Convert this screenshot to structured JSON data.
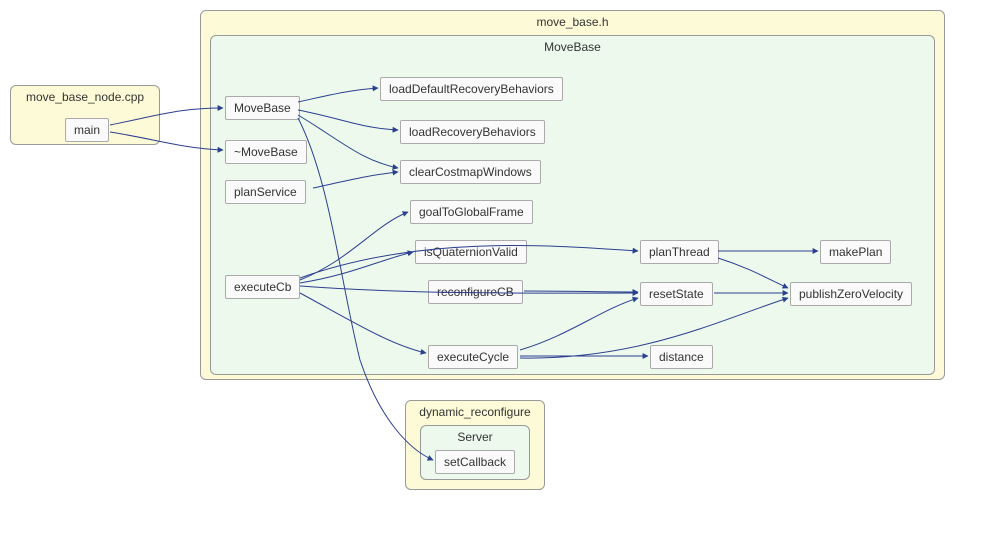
{
  "clusters": {
    "move_base_h": "move_base.h",
    "movebase_class": "MoveBase",
    "move_base_node_cpp": "move_base_node.cpp",
    "dynamic_reconfigure": "dynamic_reconfigure",
    "server": "Server"
  },
  "nodes": {
    "main": "main",
    "MoveBase": "MoveBase",
    "dMoveBase": "~MoveBase",
    "planService": "planService",
    "executeCb": "executeCb",
    "loadDefaultRecoveryBehaviors": "loadDefaultRecoveryBehaviors",
    "loadRecoveryBehaviors": "loadRecoveryBehaviors",
    "clearCostmapWindows": "clearCostmapWindows",
    "goalToGlobalFrame": "goalToGlobalFrame",
    "isQuaternionValid": "isQuaternionValid",
    "reconfigureCB": "reconfigureCB",
    "executeCycle": "executeCycle",
    "planThread": "planThread",
    "resetState": "resetState",
    "distance": "distance",
    "makePlan": "makePlan",
    "publishZeroVelocity": "publishZeroVelocity",
    "setCallback": "setCallback"
  }
}
